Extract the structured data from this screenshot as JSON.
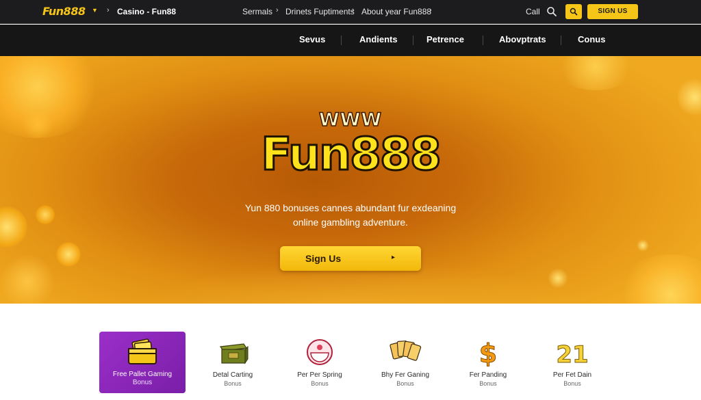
{
  "topbar": {
    "logo": "Fun888",
    "breadcrumb_current": "Casino - Fun88",
    "links": [
      "Sermals",
      "Drinets Fuptiments",
      "About year Fun888"
    ],
    "call": "Call",
    "signup": "SIGN US"
  },
  "nav": {
    "items": [
      "Sevus",
      "Andients",
      "Petrence",
      "Abovptrats",
      "Conus"
    ]
  },
  "hero": {
    "www": "WWW",
    "brand": "Fun888",
    "tagline_line1": "Yun 880 bonuses cannes abundant fur exdeaning",
    "tagline_line2": "online gambling adventure.",
    "cta": "Sign Us",
    "cta_arrow": "▸"
  },
  "cards": [
    {
      "title": "Free Pallet Gaming",
      "sub": "Bonus",
      "icon": "money-stack-icon",
      "active": true
    },
    {
      "title": "Detal Carting",
      "sub": "Bonus",
      "icon": "treasure-chest-icon",
      "active": false
    },
    {
      "title": "Per Per Spring",
      "sub": "Bonus",
      "icon": "roulette-wheel-icon",
      "active": false
    },
    {
      "title": "Bhy Fer Ganing",
      "sub": "Bonus",
      "icon": "playing-cards-icon",
      "active": false
    },
    {
      "title": "Fer Panding",
      "sub": "Bonus",
      "icon": "dollar-sign-icon",
      "active": false
    },
    {
      "title": "Per Fet Dain",
      "sub": "Bonus",
      "icon": "blackjack-21-icon",
      "active": false
    }
  ],
  "colors": {
    "accent": "#f5c518",
    "topbar": "#1c1c1e",
    "nav": "#161616",
    "active_card": "#8a25b8",
    "hero_orange": "#d07a0c"
  }
}
